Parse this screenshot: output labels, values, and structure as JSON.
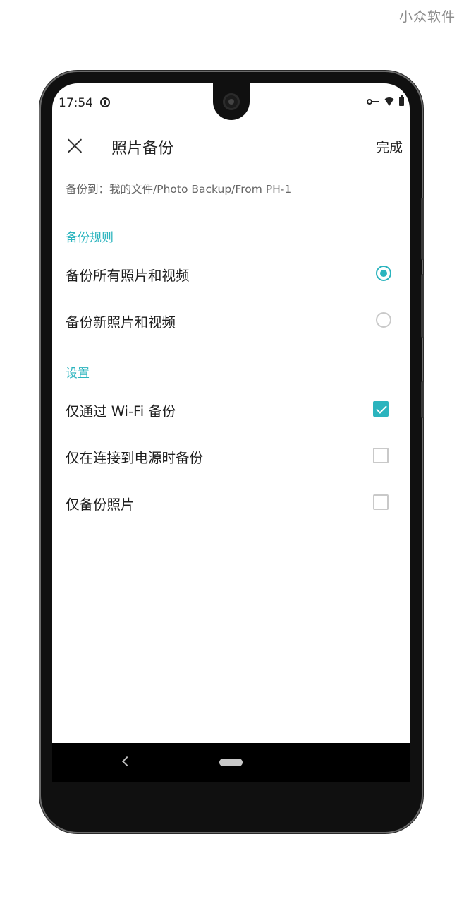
{
  "watermark": "小众软件",
  "status_bar": {
    "time": "17:54",
    "icons": [
      "sync-icon",
      "vpn-key-icon",
      "wifi-icon",
      "battery-icon"
    ]
  },
  "app_bar": {
    "close_icon": "close-icon",
    "title": "照片备份",
    "done_label": "完成"
  },
  "backup_path": "备份到：我的文件/Photo Backup/From PH-1",
  "rules_section": {
    "title": "备份规则",
    "options": [
      {
        "label": "备份所有照片和视频",
        "selected": true
      },
      {
        "label": "备份新照片和视频",
        "selected": false
      }
    ]
  },
  "settings_section": {
    "title": "设置",
    "options": [
      {
        "label": "仅通过 Wi-Fi 备份",
        "checked": true
      },
      {
        "label": "仅在连接到电源时备份",
        "checked": false
      },
      {
        "label": "仅备份照片",
        "checked": false
      }
    ]
  },
  "nav_bar": {
    "back_icon": "back-icon",
    "home_icon": "home-pill-icon"
  },
  "colors": {
    "accent": "#2bb4be",
    "text": "#1e1e1e",
    "muted": "#666666"
  }
}
